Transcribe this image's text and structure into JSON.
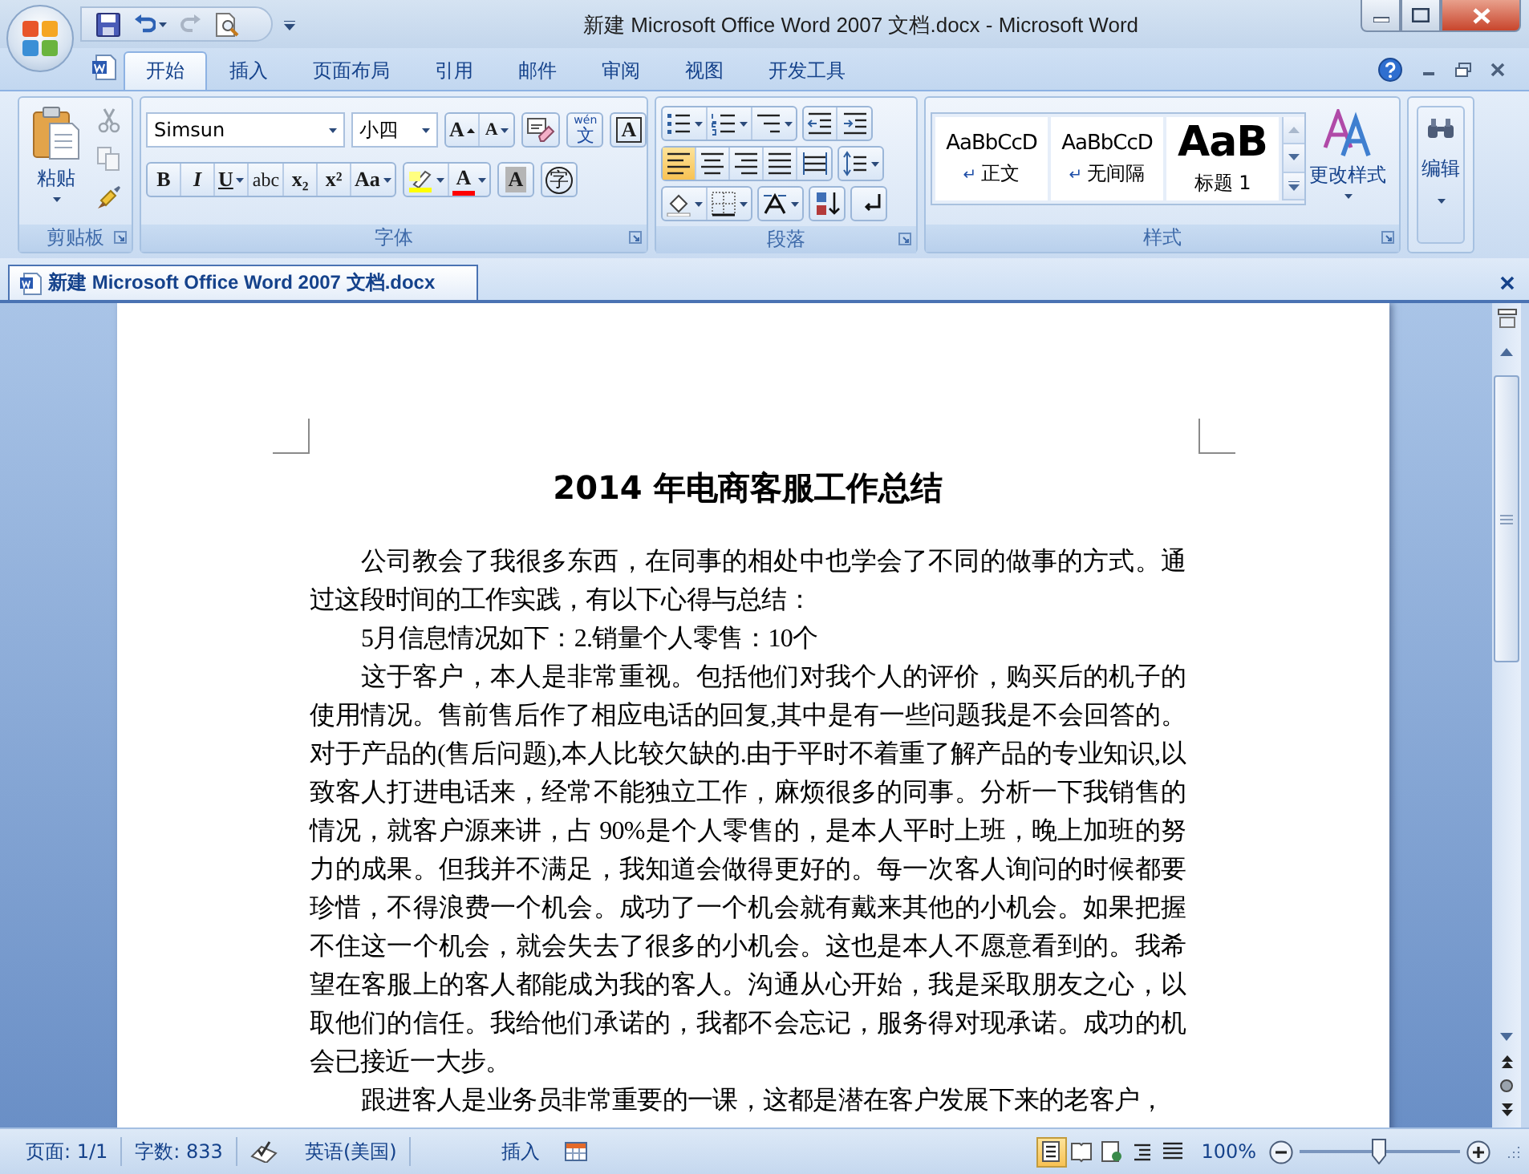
{
  "window": {
    "title": "新建 Microsoft Office Word 2007 文档.docx - Microsoft Word"
  },
  "tabs": [
    {
      "label": "开始",
      "selected": true
    },
    {
      "label": "插入",
      "selected": false
    },
    {
      "label": "页面布局",
      "selected": false
    },
    {
      "label": "引用",
      "selected": false
    },
    {
      "label": "邮件",
      "selected": false
    },
    {
      "label": "审阅",
      "selected": false
    },
    {
      "label": "视图",
      "selected": false
    },
    {
      "label": "开发工具",
      "selected": false
    }
  ],
  "ribbon": {
    "clipboard": {
      "title": "剪贴板",
      "paste_label": "粘贴"
    },
    "font": {
      "title": "字体",
      "font_name": "Simsun",
      "font_size": "小四",
      "row1": [
        [
          {
            "kind": "grow",
            "glyph": "A"
          },
          {
            "kind": "shrink",
            "glyph": "A"
          }
        ],
        [
          {
            "kind": "clear"
          }
        ],
        [
          {
            "kind": "phonetic",
            "glyph": "文",
            "ruby": "wén"
          }
        ],
        [
          {
            "kind": "border",
            "glyph": "A"
          }
        ]
      ],
      "row2": [
        [
          {
            "kind": "bold",
            "glyph": "B"
          },
          {
            "kind": "italic",
            "glyph": "I"
          },
          {
            "kind": "underline",
            "glyph": "U"
          },
          {
            "kind": "strike",
            "glyph": "abc"
          },
          {
            "kind": "subscript",
            "glyph": "x₂"
          },
          {
            "kind": "superscript",
            "glyph": "x²"
          },
          {
            "kind": "case",
            "glyph": "Aa"
          }
        ],
        [
          {
            "kind": "highlight",
            "color": "#ffff00"
          },
          {
            "kind": "color",
            "glyph": "A",
            "color": "#ff0000"
          }
        ],
        [
          {
            "kind": "shading",
            "glyph": "A"
          }
        ],
        [
          {
            "kind": "enclosed",
            "glyph": "字"
          }
        ]
      ]
    },
    "paragraph": {
      "title": "段落",
      "align_buttons": [
        {
          "selected": true
        },
        {
          "selected": false
        },
        {
          "selected": false
        },
        {
          "selected": false
        },
        {
          "selected": false
        }
      ]
    },
    "styles": {
      "title": "样式",
      "gallery": [
        {
          "kind": "body",
          "sample": "AaBbCcD",
          "mark": "↵",
          "name": "正文"
        },
        {
          "kind": "body",
          "sample": "AaBbCcD",
          "mark": "↵",
          "name": "无间隔"
        },
        {
          "kind": "heading",
          "sample": "AaB",
          "name": "标题 1"
        }
      ],
      "change_label": "更改样式"
    },
    "editing": {
      "label": "编辑"
    }
  },
  "document_tab": {
    "label": "新建 Microsoft Office Word 2007 文档.docx"
  },
  "document": {
    "title": "2014 年电商客服工作总结",
    "paragraphs": [
      "公司教会了我很多东西，在同事的相处中也学会了不同的做事的方式。通过这段时间的工作实践，有以下心得与总结：",
      "5月信息情况如下：2.销量个人零售：10个",
      "这于客户，本人是非常重视。包括他们对我个人的评价，购买后的机子的使用情况。售前售后作了相应电话的回复,其中是有一些问题我是不会回答的。对于产品的(售后问题),本人比较欠缺的.由于平时不着重了解产品的专业知识,以致客人打进电话来，经常不能独立工作，麻烦很多的同事。分析一下我销售的情况，就客户源来讲，占 90%是个人零售的，是本人平时上班，晚上加班的努力的成果。但我并不满足，我知道会做得更好的。每一次客人询问的时候都要珍惜，不得浪费一个机会。成功了一个机会就有戴来其他的小机会。如果把握不住这一个机会，就会失去了很多的小机会。这也是本人不愿意看到的。我希望在客服上的客人都能成为我的客人。沟通从心开始，我是采取朋友之心，以取他们的信任。我给他们承诺的，我都不会忘记，服务得对现承诺。成功的机会已接近一大步。",
      "跟进客人是业务员非常重要的一课，这都是潜在客户发展下来的老客户，"
    ]
  },
  "status_bar": {
    "page": "页面: 1/1",
    "words": "字数: 833",
    "language": "英语(美国)",
    "mode": "插入",
    "views": [
      {
        "selected": true
      },
      {
        "selected": false
      },
      {
        "selected": false
      },
      {
        "selected": false
      },
      {
        "selected": false
      }
    ],
    "zoom": "100%",
    "zoom_slider": {
      "level": 0.5
    }
  }
}
